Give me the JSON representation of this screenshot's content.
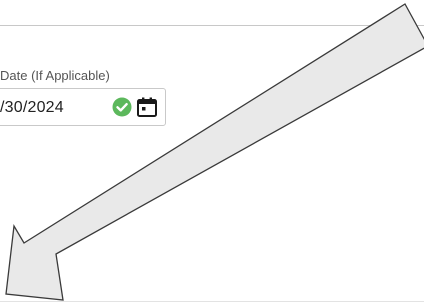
{
  "form": {
    "date_field": {
      "label": "Date (If Applicable)",
      "value": "/30/2024"
    }
  },
  "icons": {
    "valid": "check-circle-icon",
    "calendar": "calendar-icon"
  },
  "colors": {
    "valid_green": "#5cb85c",
    "arrow_fill": "#e9e9e9",
    "arrow_stroke": "#3a3a3a"
  }
}
